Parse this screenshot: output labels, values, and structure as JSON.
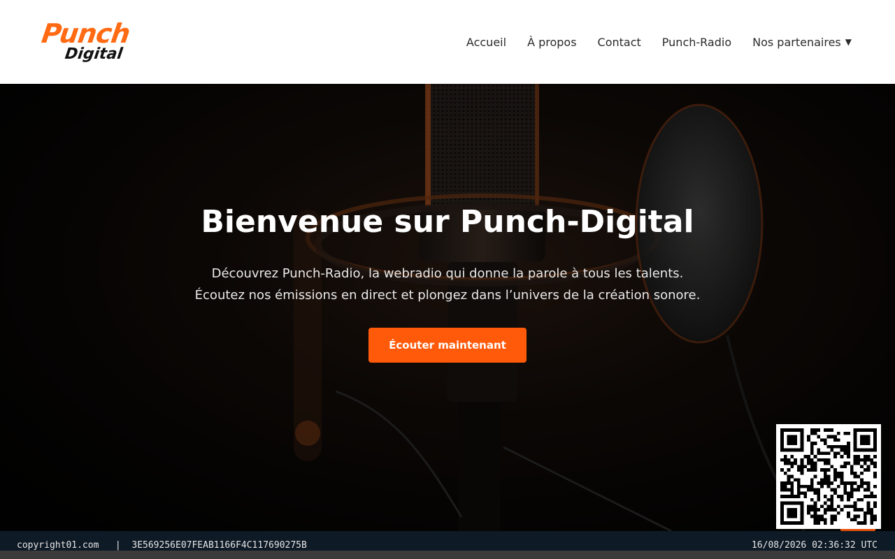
{
  "header": {
    "logo": {
      "line1": "Punch",
      "line2": "Digital"
    },
    "nav": [
      {
        "label": "Accueil"
      },
      {
        "label": "À propos"
      },
      {
        "label": "Contact"
      },
      {
        "label": "Punch-Radio"
      },
      {
        "label": "Nos partenaires",
        "dropdown_icon": "chevron-down-icon",
        "caret": "▼"
      }
    ]
  },
  "hero": {
    "title": "Bienvenue sur Punch-Digital",
    "subtitle_line1": "Découvrez Punch-Radio, la webradio qui donne la parole à tous les talents.",
    "subtitle_line2": "Écoutez nos émissions en direct et plongez dans l’univers de la création sonore.",
    "cta_label": "Écouter maintenant"
  },
  "footer": {
    "domain": "copyright01.com",
    "separator": "|",
    "hash": "3E569256E07FEAB1166F4C117690275B",
    "timestamp": "16/08/2026 02:36:32 UTC"
  },
  "colors": {
    "accent": "#ff5a0a",
    "logo_orange": "#ff6a13",
    "header_bg": "#ffffff",
    "footer_bg": "#0e1a26"
  }
}
